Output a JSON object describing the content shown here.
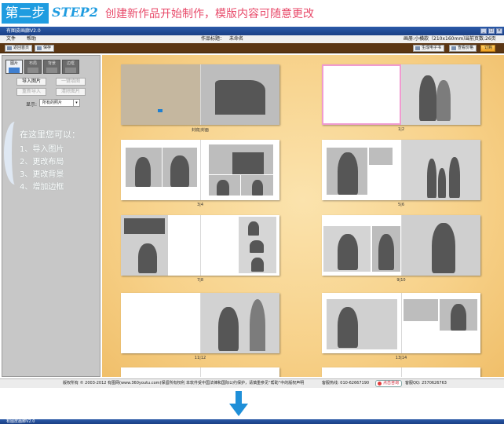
{
  "banner": {
    "step_cn": "第二步",
    "step_en": "STEP2",
    "text": "创建新作品开始制作，模版内容可随意更改"
  },
  "window": {
    "title": "有图皮画廊V2.0",
    "bottom_title": "有图皮画廊V2.0",
    "controls": [
      "_",
      "□",
      "×"
    ]
  },
  "menu": {
    "file": "文件",
    "help": "帮助",
    "work_title_label": "作品标题：",
    "work_title": "未命名",
    "size": "画册:小横款（210x160mm）",
    "pages": "当前页数:26页"
  },
  "toolbar": {
    "back_home": "返回首页",
    "save": "保存",
    "gen_ebook": "生成电子书",
    "view_price": "查看价格",
    "order": "订购"
  },
  "panel": {
    "tabs": [
      {
        "label": "图片",
        "active": true
      },
      {
        "label": "布局",
        "active": false
      },
      {
        "label": "背景",
        "active": false
      },
      {
        "label": "边框",
        "active": false
      }
    ],
    "import_photo": "导入图片",
    "one_key_fill": "一键填图",
    "reimport": "重新导入",
    "clear_photo": "清除图片",
    "show_label": "显示:",
    "show_select": "所有的照片",
    "hint_title": "在这里您可以：",
    "hints": [
      "1、导入图片",
      "2、更改布局",
      "3、更改背景",
      "4、增加边框"
    ]
  },
  "spreads": {
    "labels": [
      "封底|封面",
      "1|2",
      "3|4",
      "5|6",
      "7|8",
      "9|10",
      "11|12",
      "13|14"
    ]
  },
  "status": {
    "copyright": "版权所有 © 2003-2012 有图网(www.360youtu.com)保留所有权利  本软件受中国法律和国际公约保护，请慎重参见“帮助”中的版权声明",
    "hotline": "客服热线: 010-62667190",
    "consult": "点击咨询",
    "qq": "客服QQ: 2570626763"
  },
  "colors": {
    "accent": "#1f9ce0",
    "banner_text": "#e84a6a",
    "toolbar": "#5b3613",
    "canvas": "#f7d189",
    "selection": "#f09bd0"
  }
}
